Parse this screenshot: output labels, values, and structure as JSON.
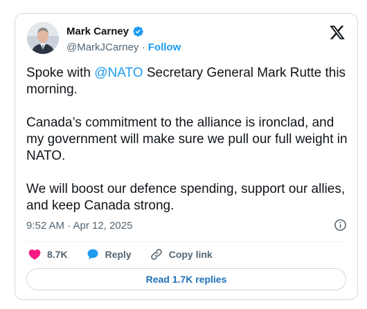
{
  "author": {
    "name": "Mark Carney",
    "handle": "@MarkJCarney",
    "separator": "·",
    "follow_label": "Follow",
    "verified_icon": "verified-badge-icon"
  },
  "tweet": {
    "text_prefix": "Spoke with ",
    "mention": "@NATO",
    "text_suffix": " Secretary General Mark Rutte this morning.",
    "paragraph_2": "Canada’s commitment to the alliance is ironclad, and my government will make sure we pull our full weight in NATO.",
    "paragraph_3": "We will boost our defence spending, support our allies, and keep Canada strong.",
    "timestamp": "9:52 AM · Apr 12, 2025"
  },
  "actions": {
    "like_count": "8.7K",
    "reply_label": "Reply",
    "copy_link_label": "Copy link"
  },
  "read_replies_label": "Read 1.7K replies",
  "colors": {
    "accent": "#1d9bf0",
    "like": "#f91880",
    "text": "#0f1419",
    "muted": "#536471"
  }
}
